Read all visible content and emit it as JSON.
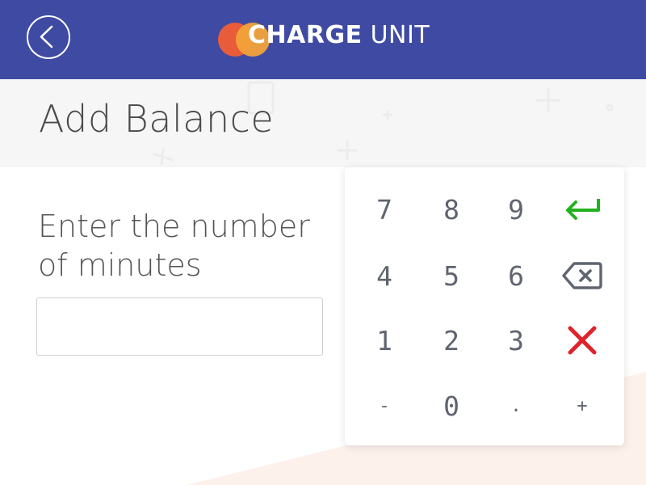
{
  "header": {
    "brand_bold": "CHARGE",
    "brand_light": " UNIT",
    "brand_colors": {
      "circle_left": "#e85c3a",
      "circle_right": "#f2a23a"
    },
    "bg_color": "#3f4ba3",
    "back_icon": "chevron-left-circle-icon"
  },
  "page": {
    "title": "Add Balance",
    "prompt": "Enter the number of minutes",
    "input_value": "",
    "input_placeholder": ""
  },
  "keypad": {
    "rows": [
      [
        "7",
        "8",
        "9"
      ],
      [
        "4",
        "5",
        "6"
      ],
      [
        "1",
        "2",
        "3"
      ],
      [
        "-",
        "0",
        ".",
        "+"
      ]
    ],
    "action_icons": {
      "enter": "enter-icon",
      "backspace": "backspace-icon",
      "clear": "clear-x-icon"
    },
    "colors": {
      "enter": "#22b21f",
      "backspace": "#5f6470",
      "clear": "#e0222a"
    }
  }
}
